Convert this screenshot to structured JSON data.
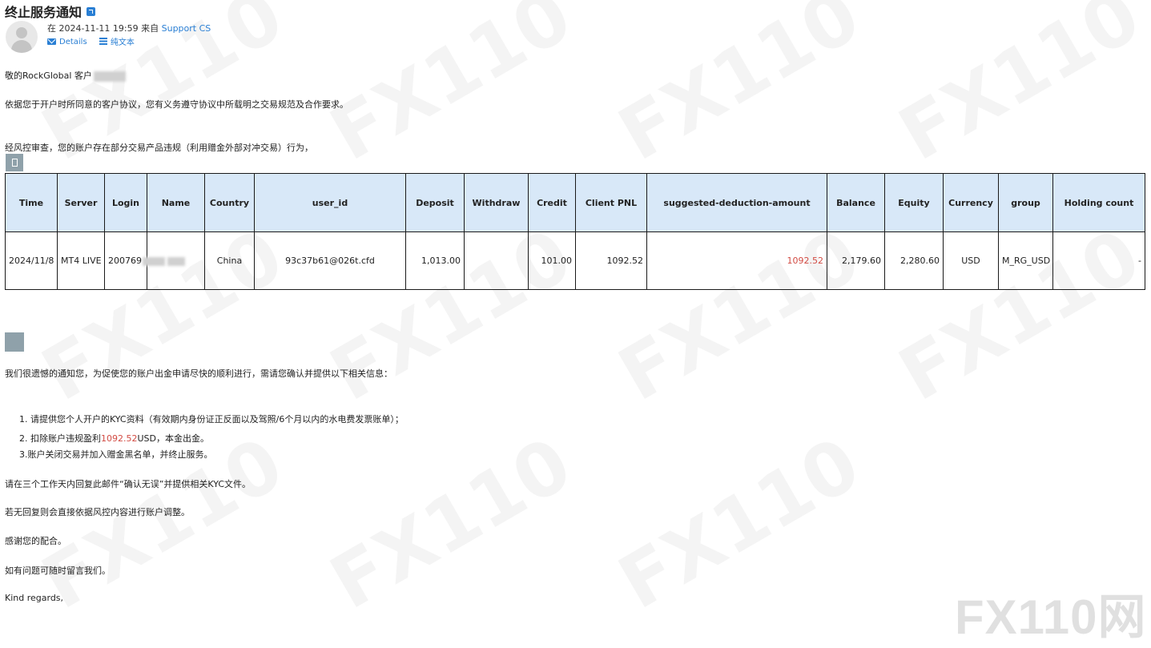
{
  "email": {
    "subject": "终止服务通知",
    "meta_prefix": "在 2024-11-11 19:59 来自",
    "sender": "Support CS",
    "actions": {
      "details_label": "Details",
      "plain_text_label": "纯文本"
    }
  },
  "body": {
    "greeting": "敬的RockGlobal 客户",
    "para1": "依据您于开户时所同意的客户协议，您有义务遵守协议中所载明之交易规范及合作要求。",
    "para2": "经风控审查，您的账户存在部分交易产品违规（利用赠金外部对冲交易）行为，",
    "para3": "我们很遗憾的通知您，为促使您的账户出金申请尽快的顺利进行，需请您确认并提供以下相关信息：",
    "list": {
      "item1": "1. 请提供您个人开户的KYC资料（有效期内身份证正反面以及驾照/6个月以内的水电费发票账单）；",
      "item2_prefix": "2. 扣除账户违规盈利",
      "item2_amount": "1092.52",
      "item2_suffix": "USD，本金出金。",
      "item3": "3.账户关闭交易并加入赠金黑名单，并终止服务。"
    },
    "para4": "请在三个工作天内回复此邮件“确认无误”并提供相关KYC文件。",
    "para5": "若无回复则会直接依据风控内容进行账户调整。",
    "para6": "感谢您的配合。",
    "para7": "如有问题可随时留言我们。",
    "closing": "Kind regards,"
  },
  "table": {
    "headers": {
      "time": "Time",
      "server": "Server",
      "login": "Login",
      "name": "Name",
      "country": "Country",
      "user_id": "user_id",
      "deposit": "Deposit",
      "withdraw": "Withdraw",
      "credit": "Credit",
      "client_pnl": "Client PNL",
      "deduction": "suggested-deduction-amount",
      "balance": "Balance",
      "equity": "Equity",
      "currency": "Currency",
      "group": "group",
      "holding_count": "Holding count"
    },
    "row": {
      "time": "2024/11/8",
      "server": "MT4 LIVE",
      "login": "200769",
      "name": "",
      "country": "China",
      "user_id": "93c37b61@026t.cfd",
      "deposit": "1,013.00",
      "withdraw": "",
      "credit": "101.00",
      "client_pnl": "1092.52",
      "deduction": "1092.52",
      "balance": "2,179.60",
      "equity": "2,280.60",
      "currency": "USD",
      "group": "M_RG_USD",
      "holding_count": "-"
    }
  },
  "watermark": {
    "text": "FX110",
    "corner": "FX110网"
  },
  "colors": {
    "link": "#2a7fd4",
    "header_bg": "#d8e8f8",
    "highlight_red": "#d24b43"
  }
}
